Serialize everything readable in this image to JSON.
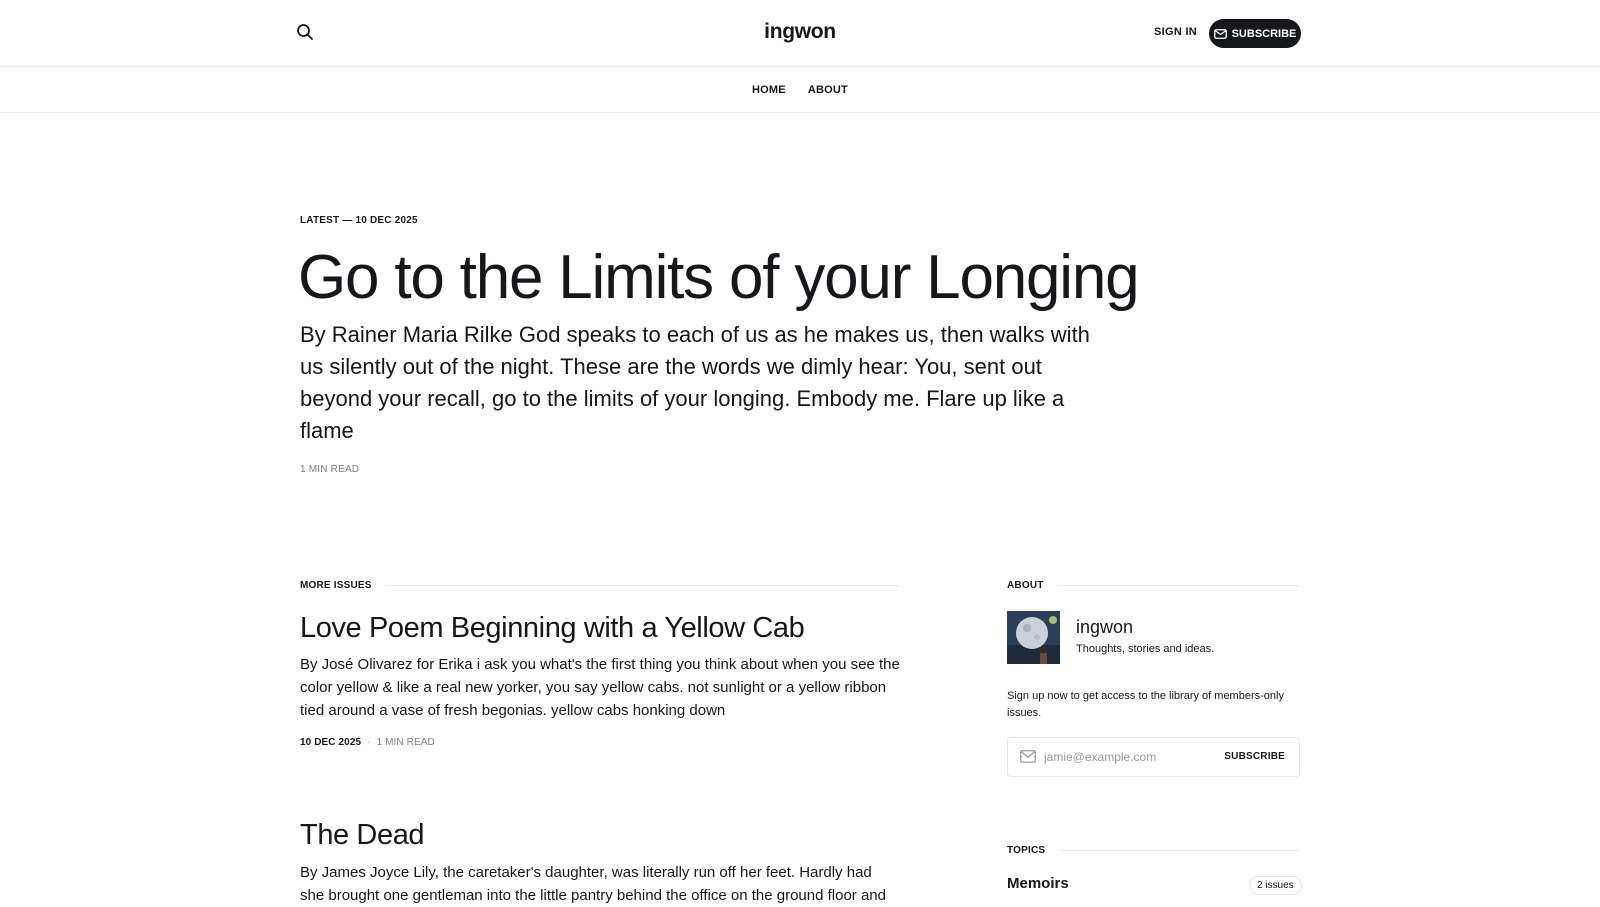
{
  "header": {
    "logo": "ingwon",
    "signin_label": "SIGN IN",
    "subscribe_label": "SUBSCRIBE",
    "search_icon": "search-icon",
    "mail_icon": "mail-icon"
  },
  "nav": {
    "items": [
      {
        "label": "HOME"
      },
      {
        "label": "ABOUT"
      }
    ]
  },
  "hero": {
    "meta": "LATEST — 10 DEC 2025",
    "title": "Go to the Limits of your Longing",
    "excerpt": "By Rainer Maria Rilke God speaks to each of us as he makes us, then walks with us silently out of the night. These are the words we dimly hear: You, sent out beyond your recall, go to the limits of your longing. Embody me. Flare up like a flame",
    "read_time": "1 MIN READ"
  },
  "more_issues": {
    "heading": "MORE ISSUES",
    "posts": [
      {
        "title": "Love Poem Beginning with a Yellow Cab",
        "excerpt": "By José Olivarez for Erika i ask you what's the first thing you think about when you see the color yellow & like a real new yorker, you say yellow cabs. not sunlight or a yellow ribbon tied around a vase of fresh begonias. yellow cabs honking down",
        "date": "10 DEC 2025",
        "separator": "·",
        "read_time": "1 MIN READ"
      },
      {
        "title": "The Dead",
        "excerpt": "By James Joyce Lily, the caretaker's daughter, was literally run off her feet. Hardly had she brought one gentleman into the little pantry behind the office on the ground floor and"
      }
    ]
  },
  "sidebar": {
    "about_heading": "ABOUT",
    "name": "ingwon",
    "description": "Thoughts, stories and ideas.",
    "signup_text": "Sign up now to get access to the library of members-only issues.",
    "email_placeholder": "jamie@example.com",
    "form_button": "SUBSCRIBE",
    "topics_heading": "TOPICS",
    "topics": [
      {
        "name": "Memoirs",
        "count": "2 issues"
      }
    ]
  },
  "colors": {
    "text": "#15171a",
    "muted": "#7c7c7c",
    "rule": "#e6e6e6",
    "button_bg": "#15171a"
  }
}
